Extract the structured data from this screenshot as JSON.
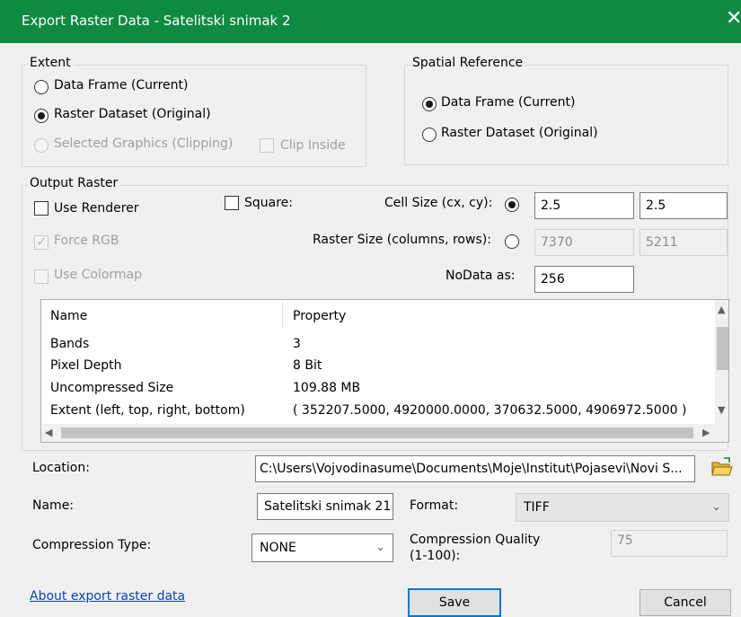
{
  "window": {
    "title": "Export Raster Data - Satelitski snimak 2",
    "close": "✕"
  },
  "extent": {
    "legend": "Extent",
    "options": [
      {
        "label": "Data Frame (Current)",
        "checked": false,
        "disabled": false
      },
      {
        "label": "Raster Dataset (Original)",
        "checked": true,
        "disabled": false
      },
      {
        "label": "Selected Graphics (Clipping)",
        "checked": false,
        "disabled": true
      }
    ],
    "clip_inside": {
      "label": "Clip Inside",
      "checked": false,
      "disabled": true
    }
  },
  "spatial_reference": {
    "legend": "Spatial Reference",
    "options": [
      {
        "label": "Data Frame (Current)",
        "checked": true
      },
      {
        "label": "Raster Dataset (Original)",
        "checked": false
      }
    ]
  },
  "output_raster": {
    "legend": "Output Raster",
    "use_renderer": {
      "label": "Use Renderer",
      "checked": false
    },
    "square": {
      "label": "Square:",
      "checked": false
    },
    "force_rgb": {
      "label": "Force RGB",
      "checked": true,
      "disabled": true
    },
    "use_colormap": {
      "label": "Use Colormap",
      "checked": false,
      "disabled": true
    },
    "cell_size": {
      "label": "Cell Size (cx, cy):",
      "cx": "2.5",
      "cy": "2.5"
    },
    "raster_size": {
      "label": "Raster Size (columns, rows):",
      "columns": "7370",
      "rows": "5211"
    },
    "nodata": {
      "label": "NoData as:",
      "value": "256"
    },
    "properties": {
      "headers": [
        "Name",
        "Property"
      ],
      "rows": [
        [
          "Bands",
          "3"
        ],
        [
          "Pixel Depth",
          "8 Bit"
        ],
        [
          "Uncompressed Size",
          "109.88 MB"
        ],
        [
          "Extent (left, top, right, bottom)",
          "( 352207.5000, 4920000.0000, 370632.5000, 4906972.5000 )"
        ]
      ]
    }
  },
  "location": {
    "label": "Location:",
    "value": "C:\\Users\\Vojvodinasume\\Documents\\Moje\\Institut\\Pojasevi\\Novi S..."
  },
  "name": {
    "label": "Name:",
    "value": "Satelitski snimak 21"
  },
  "format": {
    "label": "Format:",
    "value": "TIFF"
  },
  "compression_type": {
    "label": "Compression Type:",
    "value": "NONE"
  },
  "compression_quality": {
    "label_line1": "Compression Quality",
    "label_line2": "(1-100):",
    "value": "75"
  },
  "footer": {
    "about_link": "About export raster data",
    "save": "Save",
    "cancel": "Cancel"
  },
  "icons": {
    "folder": "open-folder-icon",
    "chevron": "chevron-down-icon"
  },
  "colors": {
    "titlebar": "#0f8a43",
    "link": "#0645ad",
    "default_button_border": "#0078d7"
  }
}
